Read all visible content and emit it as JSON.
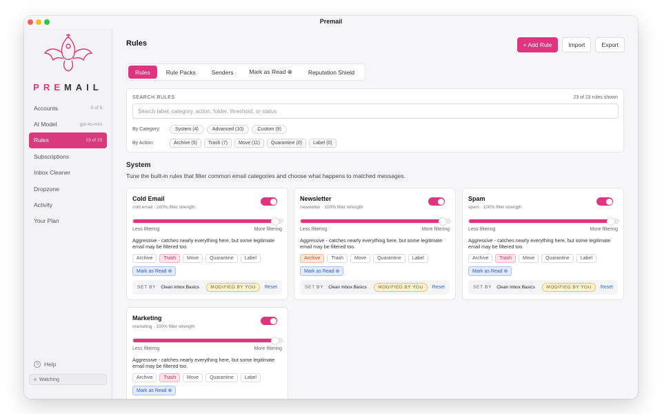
{
  "window": {
    "title": "Premail"
  },
  "brand": {
    "pre": "PRE",
    "rest": "MAIL"
  },
  "sidebar": {
    "items": [
      {
        "label": "Accounts",
        "meta": "5 of 5"
      },
      {
        "label": "AI Model",
        "meta": "gpt-4o-mini"
      },
      {
        "label": "Rules",
        "meta": "23 of 23"
      },
      {
        "label": "Subscriptions",
        "meta": ""
      },
      {
        "label": "Inbox Cleaner",
        "meta": ""
      },
      {
        "label": "Dropzone",
        "meta": ""
      },
      {
        "label": "Activity",
        "meta": ""
      },
      {
        "label": "Your Plan",
        "meta": ""
      }
    ],
    "help": "Help",
    "watching": "Watching"
  },
  "header": {
    "title": "Rules",
    "add_rule": "+ Add Rule",
    "import": "Import",
    "export": "Export"
  },
  "tabs": [
    "Rules",
    "Rule Packs",
    "Senders",
    "Mark as Read ⊕",
    "Reputation Shield"
  ],
  "search": {
    "label": "SEARCH RULES",
    "count": "23 of 23 rules shown",
    "placeholder": "Search label, category, action, folder, threshold, or status",
    "by_category_label": "By Category:",
    "categories": [
      "System (4)",
      "Advanced (10)",
      "Custom (9)"
    ],
    "by_action_label": "By Action:",
    "actions": [
      "Archive (5)",
      "Trash (7)",
      "Move (11)",
      "Quarantine (0)",
      "Label (0)"
    ]
  },
  "section": {
    "title": "System",
    "description": "Tune the built-in rules that filter common email categories and choose what happens to matched messages."
  },
  "common": {
    "less": "Less filtering",
    "more": "More filtering",
    "set_by_label": "SET BY",
    "reset": "Reset",
    "mark_as_read": "Mark as Read ⊕"
  },
  "cards": [
    {
      "name": "Cold Email",
      "sub": "cold email · 100% filter strength",
      "strength": 0.95,
      "enabled": true,
      "description": "Aggressive - catches nearly everything here, but some legitimate email may be filtered too.",
      "actions": [
        "Archive",
        "Trash",
        "Move",
        "Quarantine",
        "Label"
      ],
      "selected_action": "Trash",
      "set_by": "Clean Inbox Basics",
      "badge": "MODIFIED BY YOU"
    },
    {
      "name": "Newsletter",
      "sub": "newsletter · 100% filter strength",
      "strength": 0.95,
      "enabled": true,
      "description": "Aggressive - catches nearly everything here, but some legitimate email may be filtered too.",
      "actions": [
        "Archive",
        "Trash",
        "Move",
        "Quarantine",
        "Label"
      ],
      "selected_action": "Archive",
      "set_by": "Clean Inbox Basics",
      "badge": "MODIFIED BY YOU"
    },
    {
      "name": "Spam",
      "sub": "spam · 100% filter strength",
      "strength": 0.95,
      "enabled": true,
      "description": "Aggressive - catches nearly everything here, but some legitimate email may be filtered too.",
      "actions": [
        "Archive",
        "Trash",
        "Move",
        "Quarantine",
        "Label"
      ],
      "selected_action": "Trash",
      "set_by": "Clean Inbox Basics",
      "badge": "MODIFIED BY YOU"
    },
    {
      "name": "Marketing",
      "sub": "marketing · 100% filter strength",
      "strength": 0.95,
      "enabled": true,
      "description": "Aggressive - catches nearly everything here, but some legitimate email may be filtered too.",
      "actions": [
        "Archive",
        "Trash",
        "Move",
        "Quarantine",
        "Label"
      ],
      "selected_action": "Trash",
      "set_by": "",
      "badge": ""
    }
  ],
  "colors": {
    "accent": "#e0347f",
    "link": "#3568c9"
  }
}
